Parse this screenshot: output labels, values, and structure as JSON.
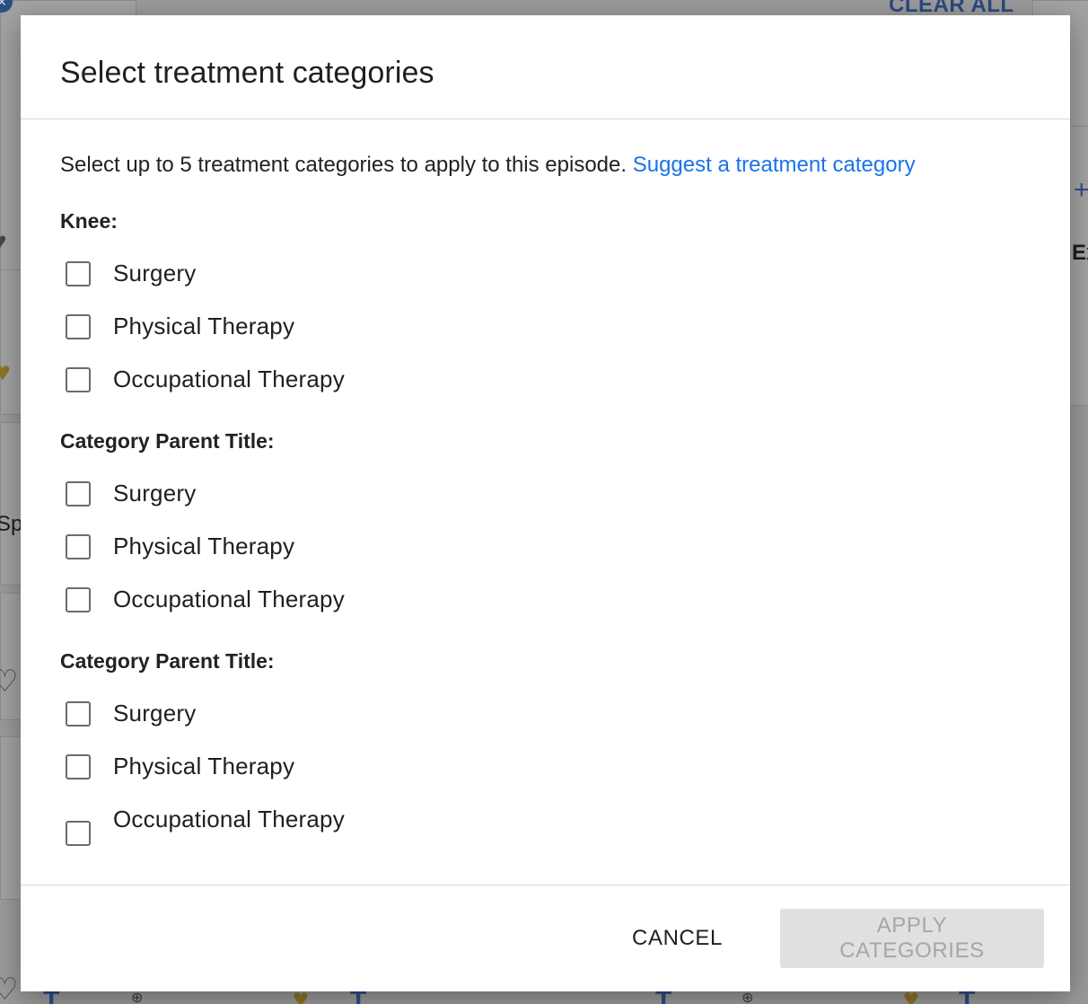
{
  "background": {
    "clear_all_label": "CLEAR ALL",
    "partial_text_ex": "Ex",
    "partial_text_sp": "Sp"
  },
  "dialog": {
    "title": "Select treatment categories",
    "intro_text": "Select up to 5 treatment categories to apply to this episode.",
    "suggest_link": "Suggest a treatment category",
    "groups": [
      {
        "heading": "Knee:",
        "options": [
          {
            "label": "Surgery",
            "checked": false
          },
          {
            "label": "Physical Therapy",
            "checked": false
          },
          {
            "label": "Occupational Therapy",
            "checked": false
          }
        ]
      },
      {
        "heading": "Category Parent Title:",
        "options": [
          {
            "label": "Surgery",
            "checked": false
          },
          {
            "label": "Physical Therapy",
            "checked": false
          },
          {
            "label": "Occupational Therapy",
            "checked": false
          }
        ]
      },
      {
        "heading": "Category Parent Title:",
        "options": [
          {
            "label": "Surgery",
            "checked": false
          },
          {
            "label": "Physical Therapy",
            "checked": false
          },
          {
            "label": "Occupational Therapy",
            "checked": false
          }
        ]
      }
    ],
    "footer": {
      "cancel_label": "CANCEL",
      "apply_label": "APPLY CATEGORIES",
      "apply_disabled": true
    }
  },
  "colors": {
    "link": "#1a73e8",
    "overlay": "#9b9b9b",
    "disabled_button_bg": "#e0e0e0",
    "disabled_button_text": "#a6a6a6"
  }
}
